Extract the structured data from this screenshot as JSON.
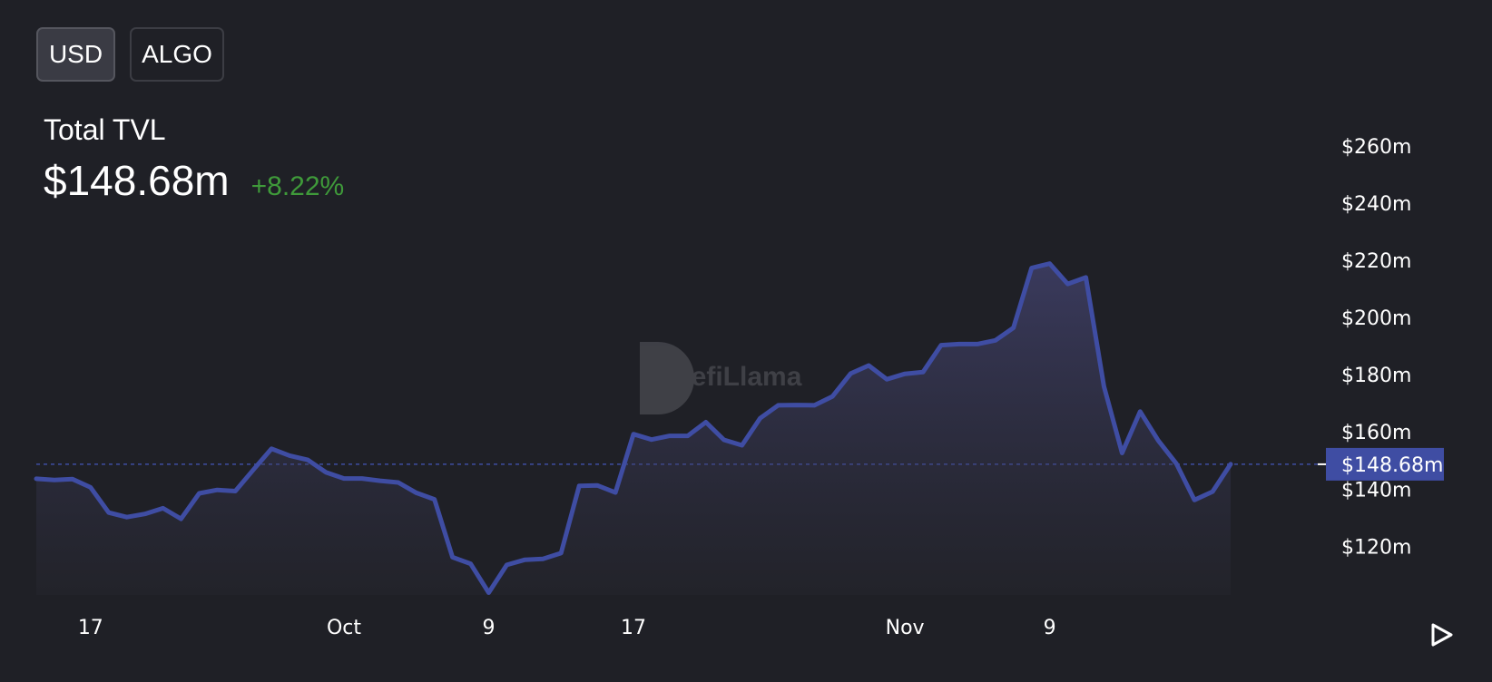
{
  "toggles": {
    "usd_label": "USD",
    "algo_label": "ALGO"
  },
  "stat": {
    "label": "Total TVL",
    "value": "$148.68m",
    "change": "+8.22%"
  },
  "watermark": "DefiLlama",
  "colors": {
    "line": "#3f4da3",
    "change_positive": "#3f9a3a",
    "background": "#1f2026"
  },
  "chart_data": {
    "type": "area",
    "title": "",
    "xlabel": "",
    "ylabel": "",
    "ylim": [
      103,
      265
    ],
    "y_ticks": [
      120,
      140,
      160,
      180,
      200,
      220,
      240,
      260
    ],
    "y_tick_labels": [
      "$120m",
      "$140m",
      "$160m",
      "$180m",
      "$200m",
      "$220m",
      "$240m",
      "$260m"
    ],
    "x_ticks": [
      {
        "x": 3,
        "label": "17"
      },
      {
        "x": 17,
        "label": "Oct"
      },
      {
        "x": 25,
        "label": "9"
      },
      {
        "x": 33,
        "label": "17"
      },
      {
        "x": 48,
        "label": "Nov"
      },
      {
        "x": 56,
        "label": "9"
      }
    ],
    "current_value": 148.68,
    "current_label": "$148.68m",
    "series": [
      {
        "values": [
          143.6,
          143.2,
          143.5,
          140.6,
          131.8,
          130.2,
          131.3,
          133.3,
          129.6,
          138.5,
          139.7,
          139.3,
          146.8,
          154.1,
          151.7,
          150.2,
          145.9,
          143.7,
          143.7,
          142.9,
          142.3,
          138.7,
          136.4,
          116.2,
          113.9,
          103.8,
          113.5,
          115.3,
          115.6,
          117.6,
          141.1,
          141.3,
          138.8,
          159.2,
          157.3,
          158.6,
          158.6,
          163.4,
          157.2,
          155.3,
          164.8,
          169.3,
          169.4,
          169.3,
          172.4,
          180.4,
          183.2,
          178.4,
          180.3,
          180.9,
          190.3,
          190.7,
          190.7,
          192.0,
          196.4,
          217.3,
          218.8,
          211.7,
          214.0,
          175.9,
          152.6,
          167.1,
          157.0,
          148.9,
          136.2,
          139.1,
          148.7
        ]
      }
    ]
  }
}
